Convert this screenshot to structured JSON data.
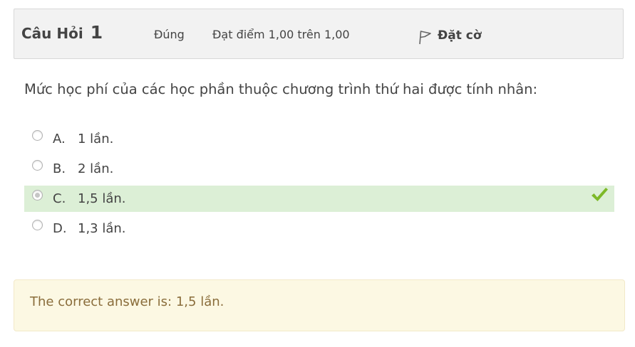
{
  "question": {
    "title_label": "Câu Hỏi",
    "number": "1",
    "state": "Đúng",
    "grade": "Đạt điểm 1,00 trên 1,00",
    "flag_label": "Đặt cờ",
    "text": "Mức học phí của các học phần thuộc chương trình thứ hai được tính nhân:"
  },
  "answers": [
    {
      "letter": "A.",
      "text": "1 lần.",
      "selected": false,
      "correct": false
    },
    {
      "letter": "B.",
      "text": "2 lần.",
      "selected": false,
      "correct": false
    },
    {
      "letter": "C.",
      "text": "1,5 lần.",
      "selected": true,
      "correct": true
    },
    {
      "letter": "D.",
      "text": "1,3 lần.",
      "selected": false,
      "correct": false
    }
  ],
  "feedback": {
    "text": "The correct answer is: 1,5 lần."
  },
  "colors": {
    "correct_bg": "#dcefd6",
    "check_green": "#7db928",
    "feedback_bg": "#fcf8e3",
    "feedback_text": "#8a6d3b"
  }
}
